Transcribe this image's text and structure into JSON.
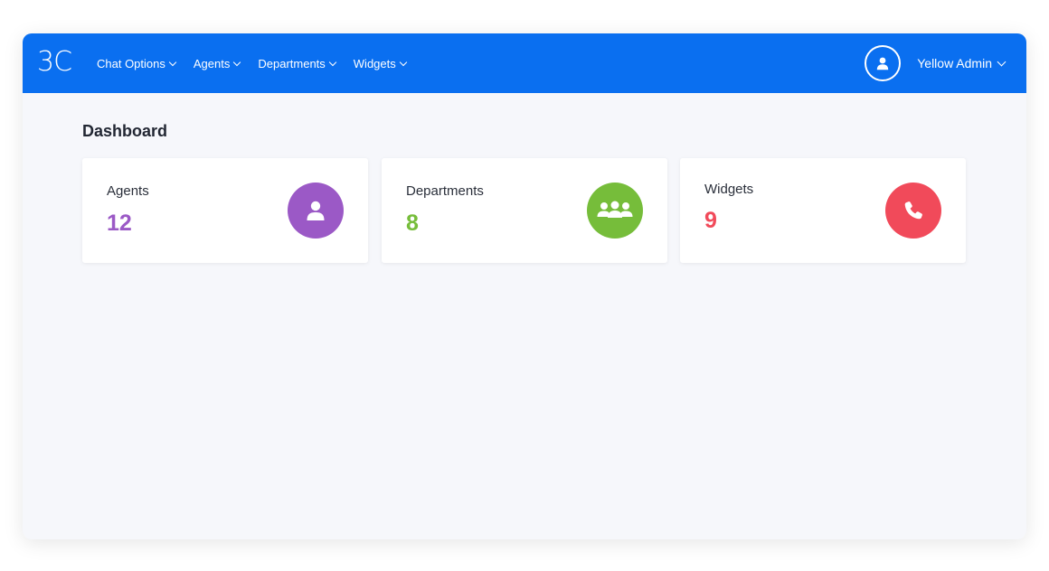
{
  "app": {
    "logo_text": "3C"
  },
  "nav": {
    "items": [
      {
        "label": "Chat Options"
      },
      {
        "label": "Agents"
      },
      {
        "label": "Departments"
      },
      {
        "label": "Widgets"
      }
    ]
  },
  "user": {
    "name": "Yellow Admin",
    "avatar_icon": "user-icon"
  },
  "page": {
    "title": "Dashboard"
  },
  "stats": [
    {
      "label": "Agents",
      "value": "12",
      "color": "#9b59c6",
      "icon": "user-icon"
    },
    {
      "label": "Departments",
      "value": "8",
      "color": "#76bd3a",
      "icon": "group-icon"
    },
    {
      "label": "Widgets",
      "value": "9",
      "color": "#f14a5a",
      "icon": "phone-icon"
    }
  ],
  "colors": {
    "topbar": "#0a6ff0",
    "background": "#f6f7fb"
  }
}
